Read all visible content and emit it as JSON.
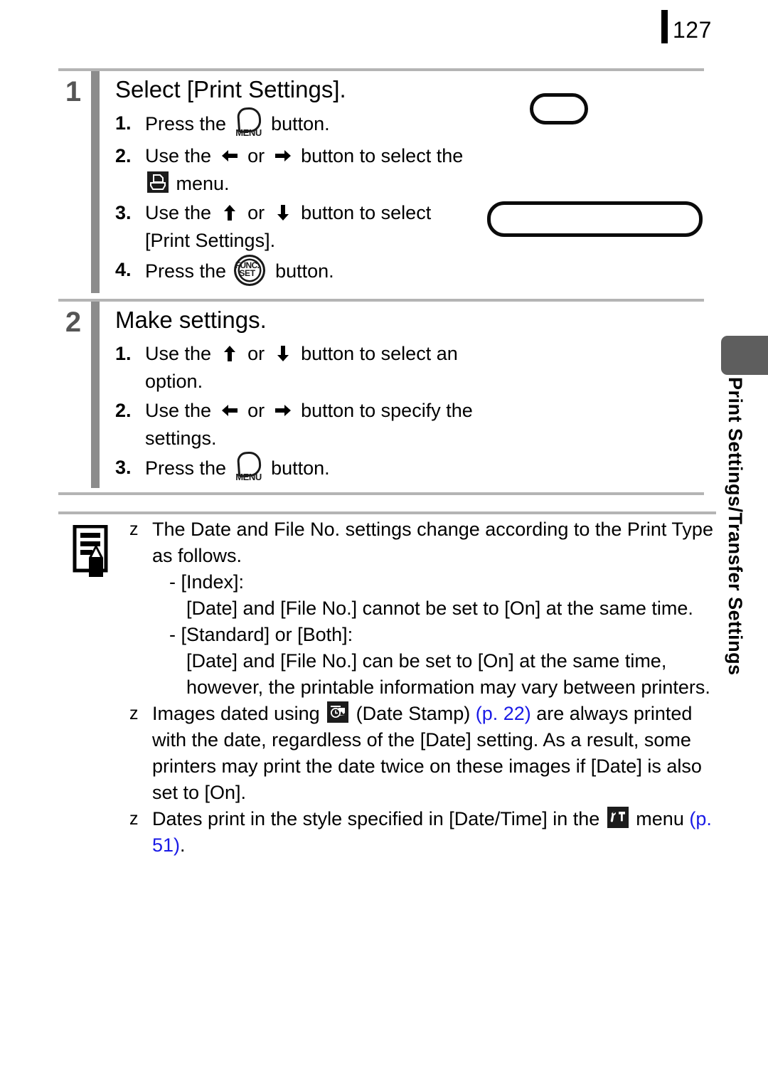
{
  "page": {
    "number": "127",
    "side_tab_label": "Print Settings/Transfer Settings",
    "link_color": "#1a1ae6",
    "step_bar_color": "#8c8c8c",
    "step_number_color": "#555555",
    "tab_color": "#5e5e5e"
  },
  "steps": [
    {
      "number": "1",
      "title": "Select [Print Settings].",
      "substeps": [
        {
          "n": "1.",
          "pre": "Press the ",
          "icon": "menu-button-icon",
          "post": " button."
        },
        {
          "n": "2.",
          "pre": "Use the ",
          "icon_a": "left-arrow-icon",
          "mid": " or ",
          "icon_b": "right-arrow-icon",
          "post": " button to select the",
          "line2_icon": "print-menu-icon",
          "line2_post": " menu."
        },
        {
          "n": "3.",
          "pre": "Use the ",
          "icon_a": "up-arrow-icon",
          "mid": " or ",
          "icon_b": "down-arrow-icon",
          "post": " button to select",
          "line2": "[Print Settings]."
        },
        {
          "n": "4.",
          "pre": "Press the ",
          "icon": "func-set-button-icon",
          "post": " button."
        }
      ]
    },
    {
      "number": "2",
      "title": "Make settings.",
      "substeps": [
        {
          "n": "1.",
          "pre": "Use the ",
          "icon_a": "up-arrow-icon",
          "mid": " or ",
          "icon_b": "down-arrow-icon",
          "post": " button to select an",
          "line2": "option."
        },
        {
          "n": "2.",
          "pre": "Use the ",
          "icon_a": "left-arrow-icon",
          "mid": " or ",
          "icon_b": "right-arrow-icon",
          "post": " button to specify the",
          "line2": "settings."
        },
        {
          "n": "3.",
          "pre": "Press the ",
          "icon": "menu-button-icon",
          "post": " button."
        }
      ]
    }
  ],
  "note": {
    "icon": "note-pencil-icon",
    "bullet": "z",
    "items": [
      {
        "text": "The Date and File No. settings change according to the Print Type as follows.",
        "sub_lines": [
          {
            "indent": 1,
            "text": "- [Index]:"
          },
          {
            "indent": 2,
            "text": "[Date] and [File No.] cannot be set to [On] at the same time."
          },
          {
            "indent": 1,
            "text": "- [Standard] or [Both]:"
          },
          {
            "indent": 2,
            "text": "[Date] and [File No.] can be set to [On] at the same time, however, the printable information may vary between printers."
          }
        ]
      },
      {
        "pre": "Images dated using ",
        "icon": "date-stamp-icon",
        "mid": " (Date Stamp) ",
        "ref": "(p. 22)",
        "post": " are always printed with the date, regardless of the [Date] setting. As a result, some printers may print the date twice on these images if [Date] is also set to [On]."
      },
      {
        "pre": "Dates print in the style specified in [Date/Time] in the ",
        "icon": "tools-menu-icon",
        "mid": " menu ",
        "ref": "(p. 51)",
        "post": "."
      }
    ]
  }
}
